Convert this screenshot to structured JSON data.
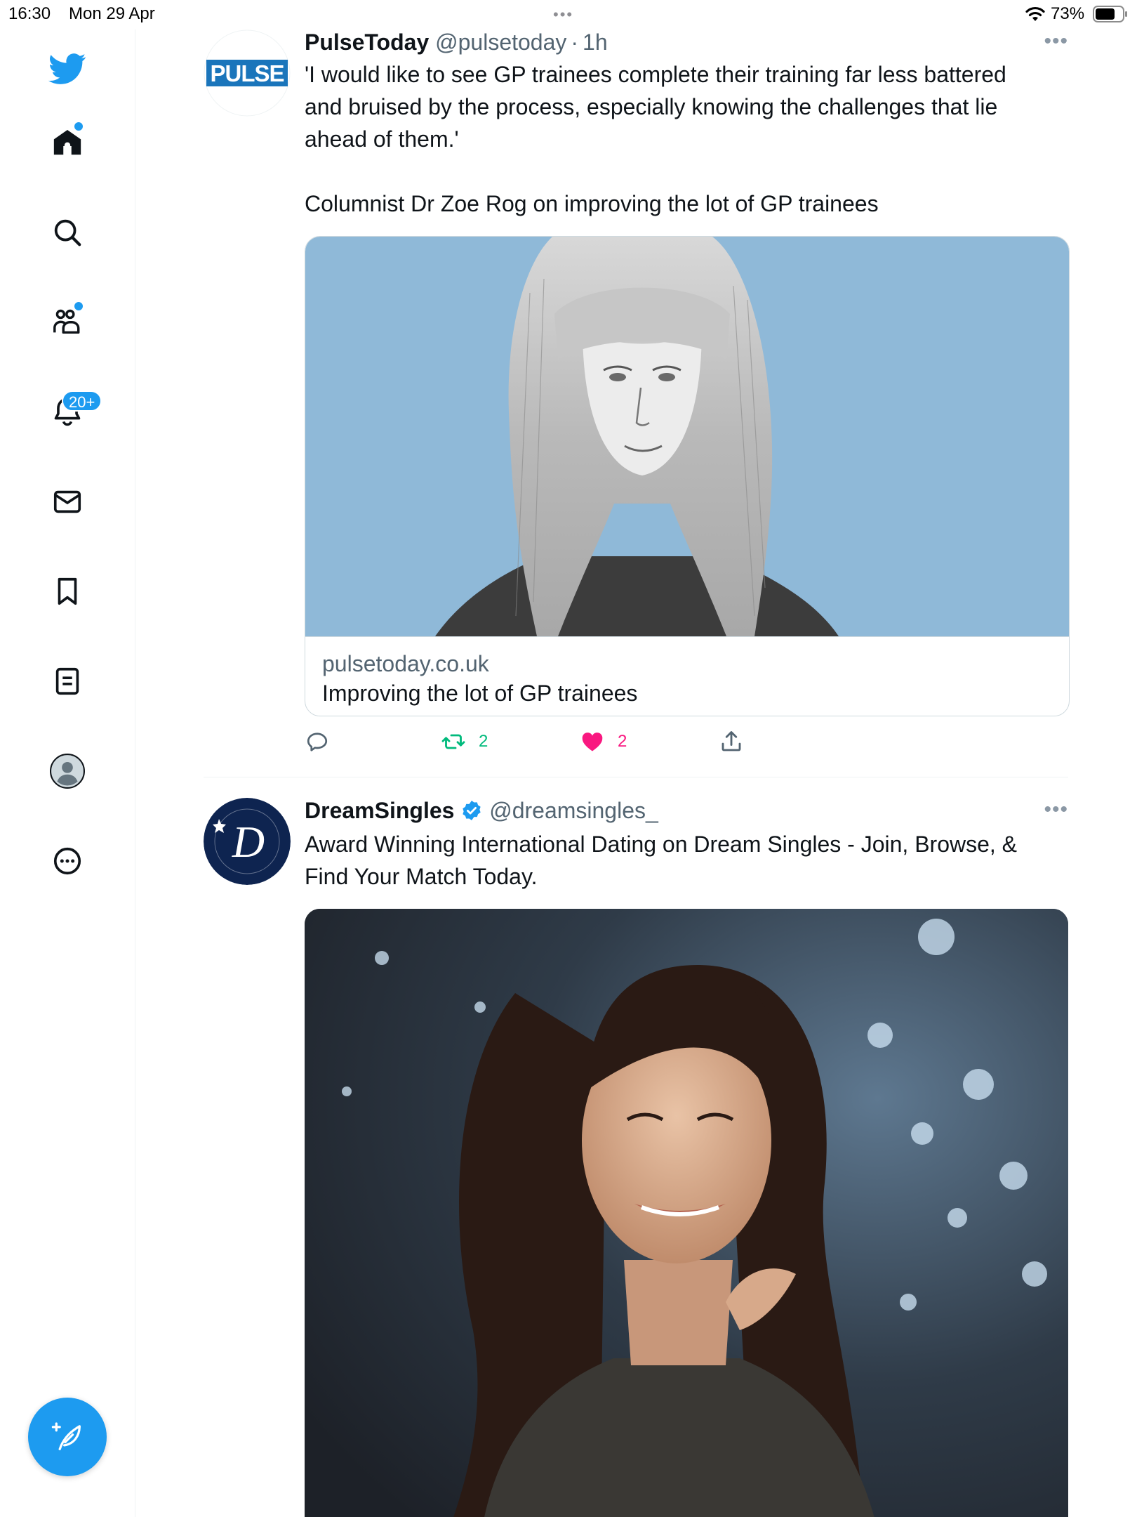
{
  "status_bar": {
    "time": "16:30",
    "date": "Mon 29 Apr",
    "battery_percent": "73%",
    "battery_level": 0.73,
    "multitask_dots": "•••"
  },
  "sidebar": {
    "items": [
      {
        "name": "twitter-logo-icon"
      },
      {
        "name": "home-icon",
        "unread_dot": true
      },
      {
        "name": "search-icon"
      },
      {
        "name": "communities-icon",
        "unread_dot": true
      },
      {
        "name": "notifications-icon",
        "badge": "20+"
      },
      {
        "name": "messages-icon"
      },
      {
        "name": "bookmarks-icon"
      },
      {
        "name": "lists-icon"
      },
      {
        "name": "profile-avatar"
      },
      {
        "name": "more-icon"
      }
    ],
    "compose_label": "Compose tweet"
  },
  "colors": {
    "accent": "#1d9bf0",
    "retweet": "#00ba7c",
    "like": "#f91880",
    "secondary_text": "#536471"
  },
  "feed": {
    "tweets": [
      {
        "name": "PulseToday",
        "handle": "@pulsetoday",
        "separator": "·",
        "time": "1h",
        "avatar_text": "PULSE",
        "more": "•••",
        "text_line1": "'I would like to see GP trainees complete their training far less battered",
        "text_line2": "and bruised by the process, especially knowing the challenges that lie",
        "text_line3": "ahead of them.'",
        "text_line4": "Columnist Dr Zoe Rog on improving the lot of GP trainees",
        "card": {
          "domain": "pulsetoday.co.uk",
          "title": "Improving the lot of GP trainees"
        },
        "retweets": "2",
        "likes": "2",
        "liked": true
      },
      {
        "name": "DreamSingles",
        "verified": true,
        "handle": "@dreamsingles_",
        "avatar_text": "D",
        "more": "•••",
        "text_line1": "Award Winning International Dating on Dream Singles - Join, Browse, &",
        "text_line2": "Find Your Match Today."
      }
    ]
  }
}
